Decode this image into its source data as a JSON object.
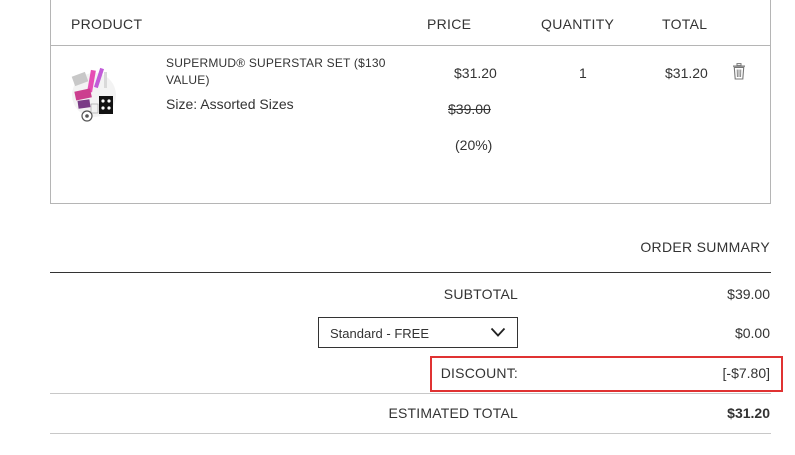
{
  "cart": {
    "headers": {
      "product": "PRODUCT",
      "price": "PRICE",
      "quantity": "QUANTITY",
      "total": "TOTAL"
    },
    "item": {
      "name": "SUPERMUD® SUPERSTAR SET ($130 VALUE)",
      "size": "Size: Assorted Sizes",
      "price_now": "$31.20",
      "price_was": "$39.00",
      "discount_pct": "(20%)",
      "quantity": "1",
      "total": "$31.20",
      "remove_icon": "trash-icon"
    }
  },
  "summary": {
    "title": "ORDER SUMMARY",
    "subtotal_label": "SUBTOTAL",
    "subtotal_value": "$39.00",
    "shipping_selected": "Standard - FREE",
    "shipping_value": "$0.00",
    "discount_label": "DISCOUNT:",
    "discount_value": "[-$7.80]",
    "estimated_total_label": "ESTIMATED TOTAL",
    "estimated_total_value": "$31.20"
  },
  "colors": {
    "highlight": "#e03232",
    "text": "#333333",
    "border": "#b5b5b5"
  }
}
